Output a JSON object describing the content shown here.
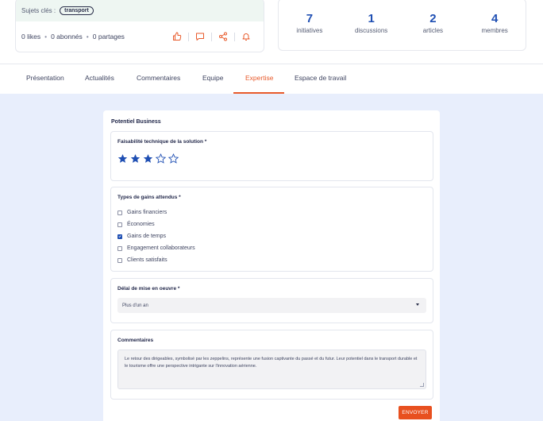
{
  "summary": {
    "topics_label": "Sujets clés :",
    "topic_chip": "transport",
    "likes": "0 likes",
    "subscribers": "0 abonnés",
    "shares": "0 partages",
    "separator": "•",
    "action_icons": [
      "thumbs-up-icon",
      "comment-icon",
      "share-icon",
      "bell-icon"
    ]
  },
  "kpis": [
    {
      "value": "7",
      "label": "initiatives"
    },
    {
      "value": "1",
      "label": "discussions"
    },
    {
      "value": "2",
      "label": "articles"
    },
    {
      "value": "4",
      "label": "membres"
    }
  ],
  "tabs": [
    {
      "label": "Présentation",
      "active": false
    },
    {
      "label": "Actualités",
      "active": false
    },
    {
      "label": "Commentaires",
      "active": false
    },
    {
      "label": "Equipe",
      "active": false
    },
    {
      "label": "Expertise",
      "active": true
    },
    {
      "label": "Espace de travail",
      "active": false
    }
  ],
  "form": {
    "title": "Potentiel Business",
    "feasibility": {
      "label": "Faisabilité technique de la solution *",
      "rating": 3,
      "max": 5
    },
    "gains": {
      "label": "Types de gains attendus *",
      "options": [
        {
          "label": "Gains financiers",
          "checked": false
        },
        {
          "label": "Économies",
          "checked": false
        },
        {
          "label": "Gains de temps",
          "checked": true
        },
        {
          "label": "Engagement collaborateurs",
          "checked": false
        },
        {
          "label": "Clients satisfaits",
          "checked": false
        }
      ]
    },
    "delay": {
      "label": "Délai de mise en oeuvre *",
      "selected": "Plus d'un an"
    },
    "comments": {
      "label": "Commentaires",
      "value": "Le retour des dirigeables, symbolisé par les zeppelins, représente une fusion captivante du passé et du futur. Leur potentiel dans le transport durable et le tourisme offre une perspective intrigante sur l'innovation aérienne."
    },
    "submit_label": "ENVOYER"
  },
  "colors": {
    "accent": "#e85a2b",
    "primary": "#1f4fb3",
    "background": "#e8eefc"
  }
}
